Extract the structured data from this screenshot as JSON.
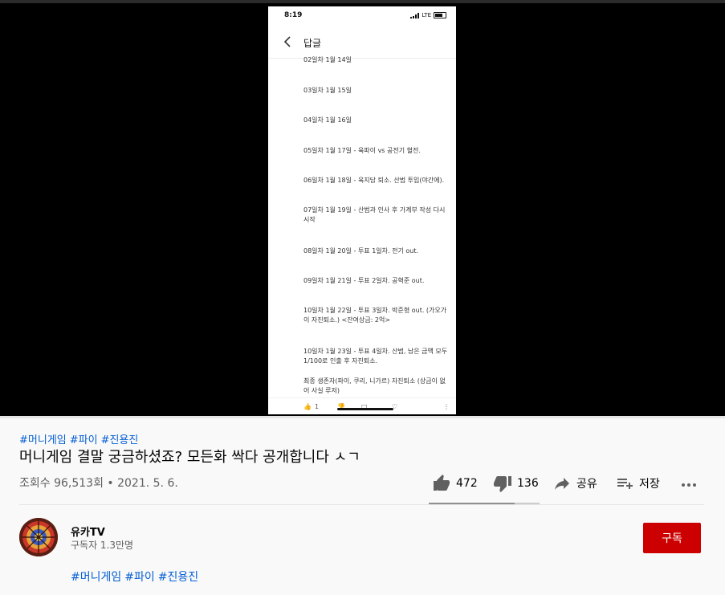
{
  "phone": {
    "time": "8:19",
    "network": "LTE",
    "header_title": "답글",
    "days": [
      "02일차 1월 14일",
      "03일차 1월 15일",
      "04일차 1월 16일",
      "05일차 1월 17일 - 육파이 vs 공전기 혈전.",
      "06일차 1월 18일 - 육지담 퇴소. 산범 투입(야간에).",
      "07일차 1월 19일 - 산범과 인사 후 가계부 작성 다시 시작",
      "08일차 1월 20일 - 투표 1일차. 전기 out.",
      "09일차 1월 21일 - 투표 2일차. 공혁준 out.",
      "10일차 1월 22일 - 투표 3일차. 박준형 out. (가오가이 자진퇴소.) <잔여상금: 2억>",
      "10일차 1월 23일 - 투표 4일차. 산범, 남은 금액 모두 1/100로 인출 후 자진퇴소.",
      "최종 생존자(파이, 쿠리, 니가르) 자진퇴소 (상금이 없어 사실 루저)"
    ],
    "like_count": "1"
  },
  "video": {
    "hashtags": [
      "#머니게임",
      "#파이",
      "#진용진"
    ],
    "title": "머니게임 결말 궁금하셨죠? 모든화 싹다 공개합니다 ㅅㄱ",
    "views": "조회수 96,513회 • 2021. 5. 6.",
    "likes": "472",
    "dislikes": "136",
    "share_label": "공유",
    "save_label": "저장",
    "like_ratio": 0.776
  },
  "channel": {
    "name": "유카TV",
    "subscribers": "구독자 1.3만명",
    "subscribe_label": "구독"
  },
  "colors": {
    "link": "#065fd4",
    "subscribe": "#cc0000"
  }
}
